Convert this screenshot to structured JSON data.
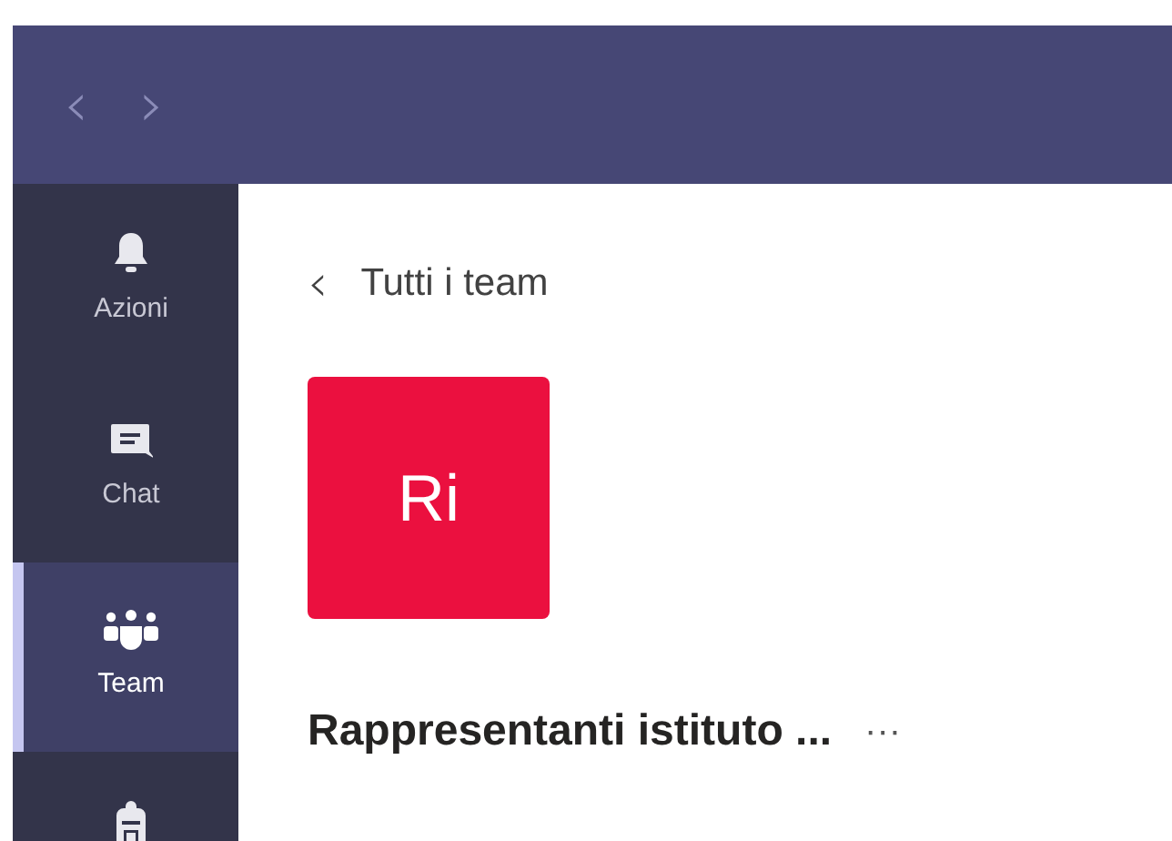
{
  "title_bar": {
    "back_button": "‹",
    "forward_button": "›"
  },
  "nav_rail": {
    "items": [
      {
        "label": "Azioni",
        "selected": false
      },
      {
        "label": "Chat",
        "selected": false
      },
      {
        "label": "Team",
        "selected": true
      },
      {
        "selected": false
      }
    ]
  },
  "content": {
    "back_link": {
      "arrow": "‹",
      "label": "Tutti i team"
    },
    "team_avatar": {
      "initials": "Ri",
      "color": "#eb103f"
    },
    "team_name": "Rappresentanti istituto ...",
    "more_button": "···"
  }
}
